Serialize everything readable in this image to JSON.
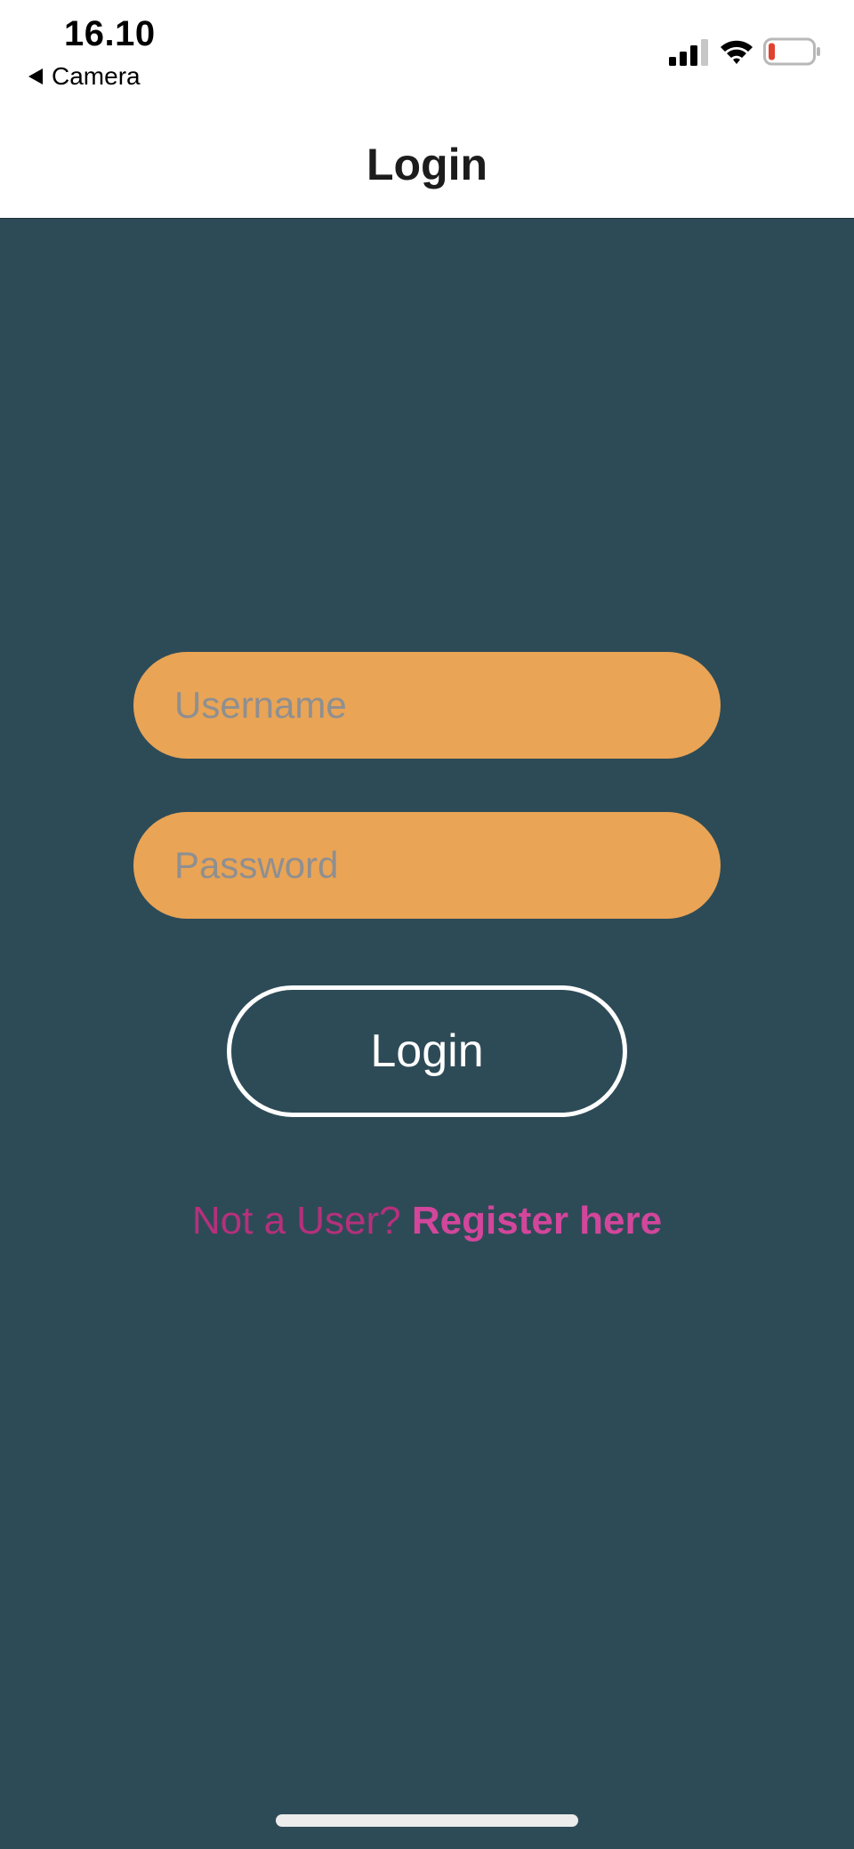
{
  "status_bar": {
    "time": "16.10",
    "back_app": "Camera",
    "icons": [
      "cellular-signal-icon",
      "wifi-icon",
      "battery-low-icon"
    ],
    "battery_level": 0.15
  },
  "nav": {
    "title": "Login"
  },
  "form": {
    "username_placeholder": "Username",
    "username_value": "",
    "password_placeholder": "Password",
    "password_value": "",
    "login_label": "Login"
  },
  "register": {
    "prompt": "Not a User?",
    "link": "Register here"
  },
  "colors": {
    "background": "#2d4b57",
    "field": "#e9a456",
    "link": "#d2469b",
    "battery_low": "#e0432f"
  }
}
